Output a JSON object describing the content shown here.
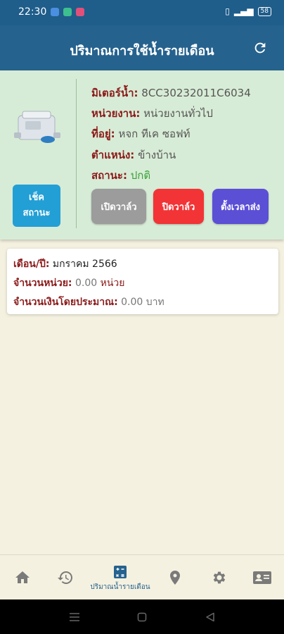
{
  "status_bar": {
    "time": "22:30",
    "battery": "58"
  },
  "app_bar": {
    "title": "ปริมาณการใช้น้ำรายเดือน"
  },
  "device": {
    "meter_label": "มิเตอร์น้ำ:",
    "meter_value": "8CC30232011C6034",
    "unit_label": "หน่วยงาน:",
    "unit_value": "หน่วยงานทั่วไป",
    "address_label": "ที่อยู่:",
    "address_value": "หจก ทีเค ซอฟท์",
    "position_label": "ตำแหน่ง:",
    "position_value": "ข้างบ้าน",
    "status_label": "สถานะ:",
    "status_value": "ปกติ",
    "check_status_button": {
      "line1": "เช็ค",
      "line2": "สถานะ"
    },
    "open_valve_button": "เปิดวาล์ว",
    "close_valve_button": "ปิดวาล์ว",
    "set_timer_button": "ตั้งเวลาส่ง"
  },
  "usage": {
    "month_label": "เดือน/ปี:",
    "month_value": "มกราคม 2566",
    "units_label": "จำนวนหน่วย:",
    "units_value": "0.00",
    "units_unit": "หน่วย",
    "cost_label": "จำนวนเงินโดยประมาณ:",
    "cost_value": "0.00 บาท"
  },
  "bottom_nav": {
    "active_label": "ปริมาณน้ำรายเดือน",
    "items": [
      "home-icon",
      "history-icon",
      "calculator-icon",
      "location-icon",
      "settings-icon",
      "contact-card-icon"
    ]
  },
  "colors": {
    "app_bar": "#26628e",
    "card_bg": "#d7ecd6",
    "label": "#8b1a1a",
    "status_ok": "#3aa03a",
    "open_btn": "#9c9c9c",
    "close_btn": "#f23436",
    "timer_btn": "#5b4fd6",
    "check_btn": "#229fd5"
  }
}
